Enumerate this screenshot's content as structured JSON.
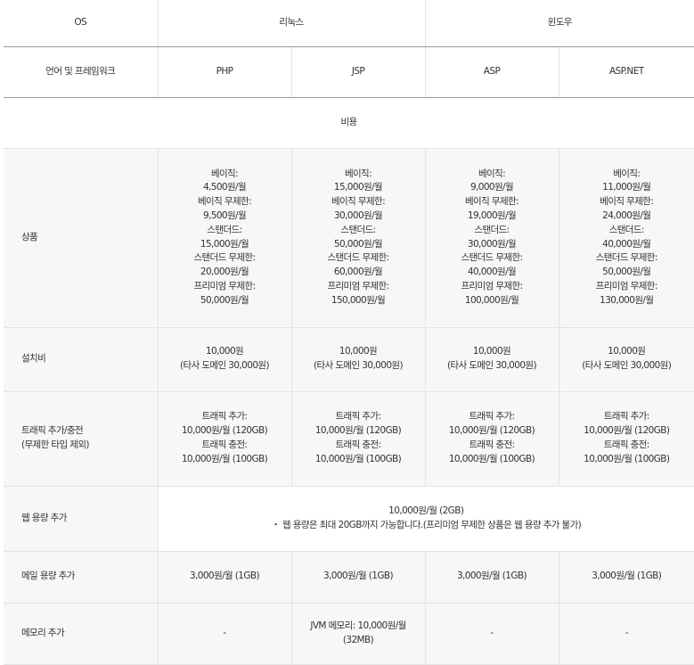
{
  "header": {
    "os_label": "OS",
    "linux": "리눅스",
    "windows": "윈도우",
    "lang_label": "언어 및 프레임워크",
    "langs": [
      "PHP",
      "JSP",
      "ASP",
      "ASP.NET"
    ]
  },
  "section_title": "비용",
  "rows": {
    "product": {
      "label": "상품",
      "cells": [
        [
          "베이직:",
          "4,500원/월",
          "베이직 무제한:",
          "9,500원/월",
          "스탠더드:",
          "15,000원/월",
          "스탠더드 무제한:",
          "20,000원/월",
          "프리미엄 무제한:",
          "50,000원/월"
        ],
        [
          "베이직:",
          "15,000원/월",
          "베이직 무제한:",
          "30,000원/월",
          "스탠더드:",
          "50,000원/월",
          "스탠더드 무제한:",
          "60,000원/월",
          "프리미엄 무제한:",
          "150,000원/월"
        ],
        [
          "베이직:",
          "9,000원/월",
          "베이직 무제한:",
          "19,000원/월",
          "스탠더드:",
          "30,000원/월",
          "스탠더드 무제한:",
          "40,000원/월",
          "프리미엄 무제한:",
          "100,000원/월"
        ],
        [
          "베이직:",
          "11,000원/월",
          "베이직 무제한:",
          "24,000원/월",
          "스탠더드:",
          "40,000원/월",
          "스탠더드 무제한:",
          "50,000원/월",
          "프리미엄 무제한:",
          "130,000원/월"
        ]
      ]
    },
    "setup": {
      "label": "설치비",
      "cells": [
        [
          "10,000원",
          "(타사 도메인 30,000원)"
        ],
        [
          "10,000원",
          "(타사 도메인 30,000원)"
        ],
        [
          "10,000원",
          "(타사 도메인 30,000원)"
        ],
        [
          "10,000원",
          "(타사 도메인 30,000원)"
        ]
      ]
    },
    "traffic": {
      "label_line1": "트래픽 추가/충전",
      "label_line2": "(무제한 타입 제외)",
      "cells": [
        [
          "트래픽 추가:",
          "10,000원/월 (120GB)",
          "트래픽 충전:",
          "10,000원/월 (100GB)"
        ],
        [
          "트래픽 추가:",
          "10,000원/월 (120GB)",
          "트래픽 충전:",
          "10,000원/월 (100GB)"
        ],
        [
          "트래픽 추가:",
          "10,000원/월 (120GB)",
          "트래픽 충전:",
          "10,000원/월 (100GB)"
        ],
        [
          "트래픽 추가:",
          "10,000원/월 (120GB)",
          "트래픽 충전:",
          "10,000원/월 (100GB)"
        ]
      ]
    },
    "web_storage": {
      "label": "웹 용량 추가",
      "price": "10,000원/월 (2GB)",
      "note": "・ 웹 용량은 최대 20GB까지 가능합니다.(프리미엄 무제한 상품은 웹 용량 추가 불가)"
    },
    "mail_storage": {
      "label": "메일 용량 추가",
      "cells": [
        "3,000원/월 (1GB)",
        "3,000원/월 (1GB)",
        "3,000원/월 (1GB)",
        "3,000원/월 (1GB)"
      ]
    },
    "memory": {
      "label": "메모리 추가",
      "cells": [
        [
          "-"
        ],
        [
          "JVM 메모리: 10,000원/월",
          "(32MB)"
        ],
        [
          "-"
        ],
        [
          "-"
        ]
      ]
    }
  }
}
